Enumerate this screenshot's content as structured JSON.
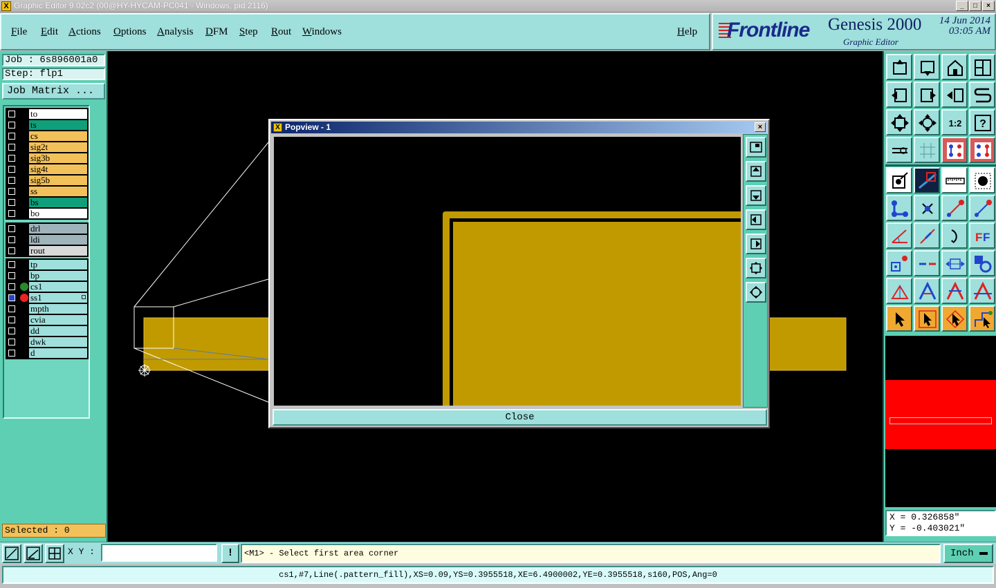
{
  "window": {
    "title": "Graphic Editor 9.02c2 (00@HY-HYCAM-PC041 - Windows, pid:2116)"
  },
  "menu": [
    "File",
    "Edit",
    "Actions",
    "Options",
    "Analysis",
    "DFM",
    "Step",
    "Rout",
    "Windows"
  ],
  "help": "Help",
  "brand": {
    "logo": "Frontline",
    "product": "Genesis 2000",
    "subtitle": "Graphic Editor",
    "date": "14 Jun 2014",
    "time": "03:05 AM"
  },
  "job": {
    "job_label": "Job : 6s896001a0",
    "step_label": "Step: flp1",
    "matrix_button": "Job Matrix ..."
  },
  "layers": {
    "group1": [
      {
        "name": "to",
        "color": "#ffffff"
      },
      {
        "name": "ts",
        "color": "#0f9f7a"
      },
      {
        "name": "cs",
        "color": "#f2c15a"
      },
      {
        "name": "sig2t",
        "color": "#f2c15a"
      },
      {
        "name": "sig3b",
        "color": "#f2c15a"
      },
      {
        "name": "sig4t",
        "color": "#f2c15a"
      },
      {
        "name": "sig5b",
        "color": "#f2c15a"
      },
      {
        "name": "ss",
        "color": "#f2c15a"
      },
      {
        "name": "bs",
        "color": "#0f9f7a"
      },
      {
        "name": "bo",
        "color": "#ffffff"
      }
    ],
    "group2": [
      {
        "name": "drl",
        "color": "#9fb3bb"
      },
      {
        "name": "ldi",
        "color": "#9fb3bb"
      },
      {
        "name": "rout",
        "color": "#d9d9d9"
      }
    ],
    "group3": [
      {
        "name": "tp",
        "color": "#9fdfdc"
      },
      {
        "name": "bp",
        "color": "#9fdfdc"
      },
      {
        "name": "cs1",
        "color": "#9fdfdc",
        "dot": "#2a8a2a"
      },
      {
        "name": "ss1",
        "color": "#9fdfdc",
        "dot": "#ee2222",
        "selected": true
      },
      {
        "name": "mpth",
        "color": "#9fdfdc"
      },
      {
        "name": "cvia",
        "color": "#9fdfdc"
      },
      {
        "name": "dd",
        "color": "#9fdfdc"
      },
      {
        "name": "dwk",
        "color": "#9fdfdc"
      },
      {
        "name": "d",
        "color": "#9fdfdc"
      }
    ]
  },
  "selected": "Selected : 0",
  "popview": {
    "title": "Popview - 1",
    "close_label": "Close"
  },
  "coords": {
    "x": "X = 0.326858\"",
    "y": "Y = -0.403021\""
  },
  "xy": {
    "label": "X Y :",
    "value": ""
  },
  "prompt": "<M1> - Select first area corner",
  "units": "Inch",
  "status": "cs1,#7,Line(.pattern_fill),XS=0.09,YS=0.3955518,XE=6.4900002,YE=0.3955518,s160,POS,Ang=0",
  "colors": {
    "panel": "#5ecfb3",
    "button": "#9fdfdc",
    "copper": "#c19a00",
    "overview_red": "#ff0000"
  }
}
